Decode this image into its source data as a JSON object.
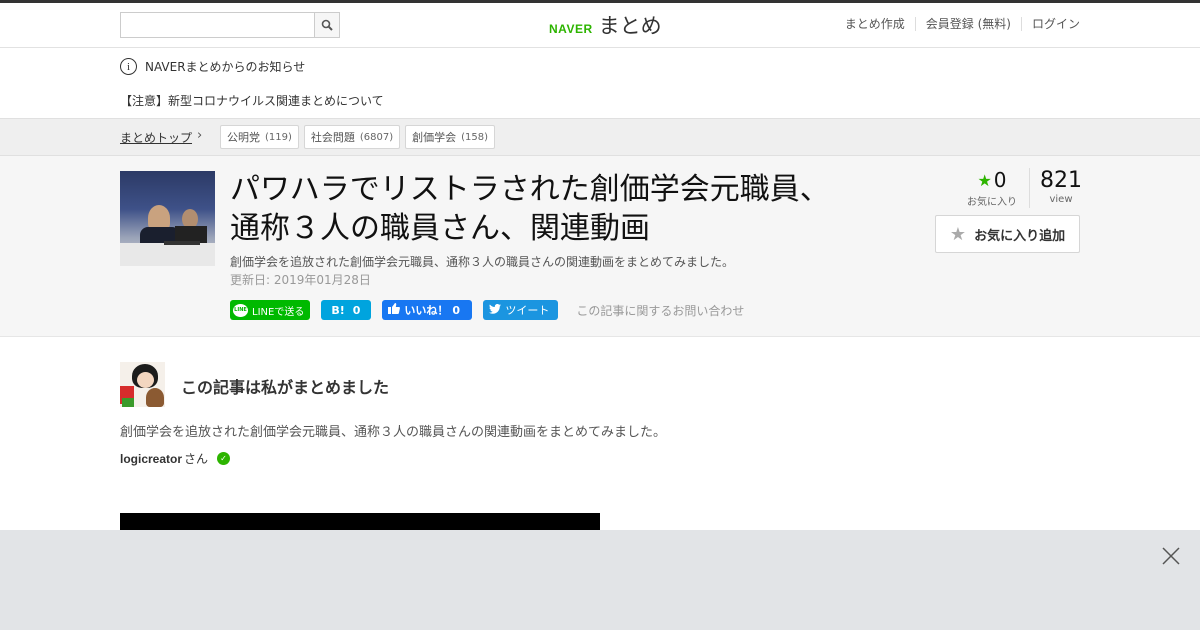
{
  "header": {
    "search_placeholder": "",
    "logo_brand": "NAVER",
    "logo_service": "まとめ",
    "links": [
      "まとめ作成",
      "会員登録 (無料)",
      "ログイン"
    ]
  },
  "notice": {
    "title": "NAVERまとめからのお知らせ",
    "link": "【注意】新型コロナウイルス関連まとめについて"
  },
  "breadcrumb": {
    "top": "まとめトップ",
    "tags": [
      {
        "label": "公明党",
        "count": "(119)"
      },
      {
        "label": "社会問題",
        "count": "(6807)"
      },
      {
        "label": "創価学会",
        "count": "(158)"
      }
    ]
  },
  "article": {
    "title": "パワハラでリストラされた創価学会元職員、通称３人の職員さん、関連動画",
    "description": "創価学会を追放された創価学会元職員、通称３人の職員さんの関連動画をまとめてみました。",
    "updated": "更新日: 2019年01月28日",
    "favorites": "0",
    "favorites_label": "お気に入り",
    "views": "821",
    "views_label": "view",
    "fav_button": "お気に入り追加",
    "contact": "この記事に関するお問い合わせ"
  },
  "share": {
    "line": "LINEで送る",
    "hatena_count": "0",
    "facebook": "いいね！",
    "facebook_count": "0",
    "twitter": "ツイート"
  },
  "author": {
    "heading": "この記事は私がまとめました",
    "description": "創価学会を追放された創価学会元職員、通称３人の職員さんの関連動画をまとめてみました。",
    "username": "logicreator",
    "suffix": "さん"
  },
  "colors": {
    "naver_green": "#2db400",
    "line_green": "#00b900",
    "hatena_blue": "#00a4de",
    "facebook_blue": "#1877f2",
    "twitter_blue": "#1b95e0"
  }
}
